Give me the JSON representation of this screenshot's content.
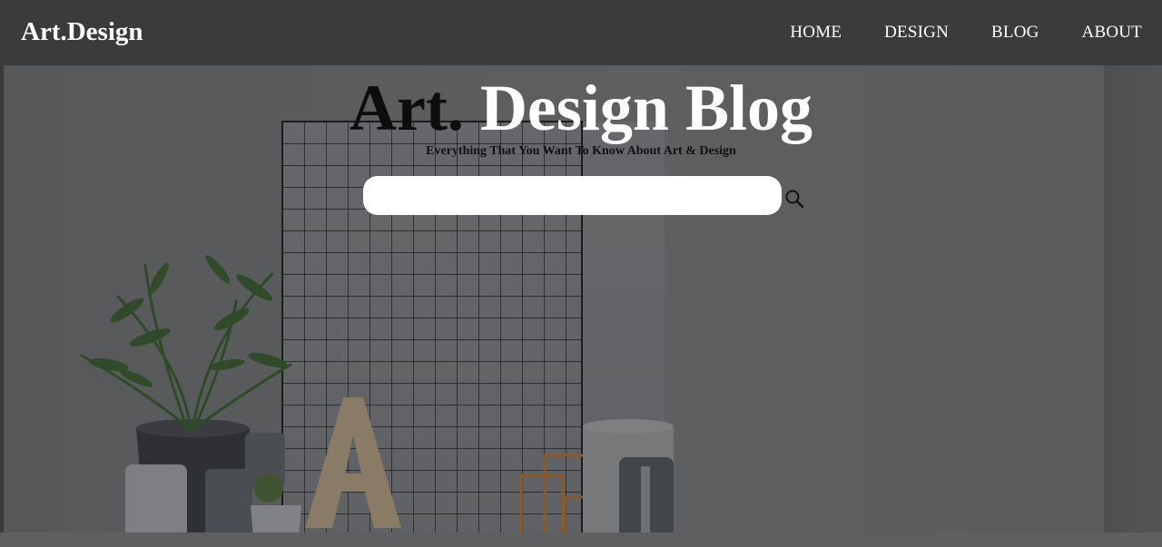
{
  "navbar": {
    "brand": "Art.Design",
    "links": [
      {
        "label": "HOME"
      },
      {
        "label": "DESIGN"
      },
      {
        "label": "BLOG"
      },
      {
        "label": "ABOUT"
      }
    ]
  },
  "hero": {
    "title_part1": "Art.",
    "title_part2": " Design Blog",
    "subtitle": "Everything That You Want To Know About Art & Design",
    "search_placeholder": "",
    "search_icon": "search-icon"
  },
  "colors": {
    "navbar_bg": "#3b3b3b",
    "hero_overlay": "#5c5e60",
    "title_dark": "#0d0d0d",
    "title_light": "#ffffff"
  }
}
